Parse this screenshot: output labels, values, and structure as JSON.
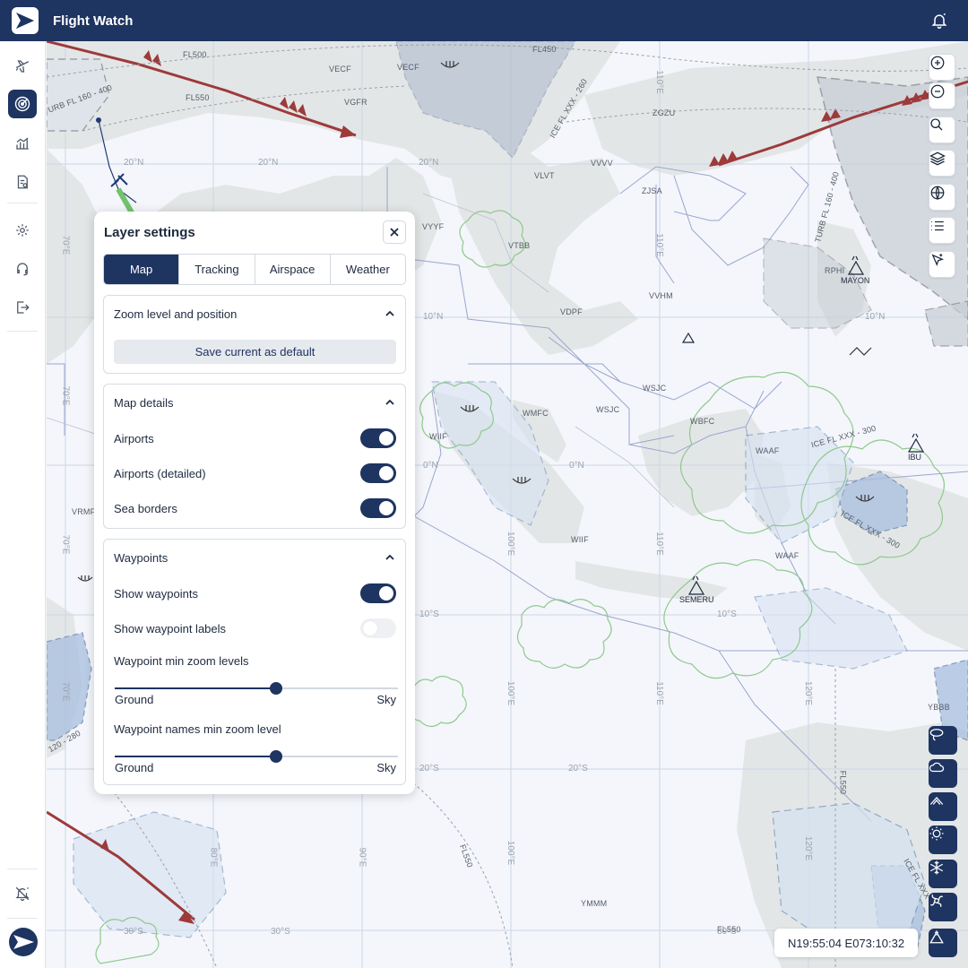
{
  "app": {
    "title": "Flight Watch"
  },
  "sidebar": {
    "items": [
      {
        "icon": "plane-icon"
      },
      {
        "icon": "radar-icon",
        "active": true
      },
      {
        "icon": "chart-icon"
      },
      {
        "icon": "report-icon"
      },
      {
        "icon": "settings-icon"
      },
      {
        "icon": "support-icon"
      },
      {
        "icon": "logout-icon"
      }
    ],
    "bottom": [
      {
        "icon": "notifications-off-icon"
      }
    ]
  },
  "map": {
    "labels": {
      "fl500": "FL500",
      "vecf": "VECF",
      "vecf_b": "VECF",
      "vgfr": "VGFR",
      "fl550": "FL550",
      "fl450": "FL450",
      "zgzu": "ZGZU",
      "vvvv": "VVVV",
      "zjsa": "ZJSA",
      "vlvt": "VLVT",
      "vyyf": "VYYF",
      "vtbb": "VTBB",
      "vdpf": "VDPF",
      "vvhm": "VVHM",
      "rphi": "RPHI",
      "wsjc": "WSJC",
      "wsjc_b": "WSJC",
      "wmfc": "WMFC",
      "wbfc": "WBFC",
      "waaf": "WAAF",
      "waaf_b": "WAAF",
      "wiif": "WIIF",
      "wiif_b": "WIIF",
      "vrmf": "VRMF",
      "yb_bb": "YBBB",
      "ymmm": "YMMM",
      "fl550_b": "FL550",
      "fl550_c": "FL550",
      "fl550_d": "FL550",
      "turb_a": "TURB FL 160 - 400",
      "turb_b": "TURB FL 160 - 400",
      "ice_a": "ICE FL XXX - 260",
      "ice_b": "ICE FL XXX - 300",
      "ice_c": "ICE FL XXX - 300",
      "ice_d": "ICE FL XXX - 240",
      "ice_e": "120 - 280"
    },
    "lat": {
      "n20a": "20°N",
      "n20b": "20°N",
      "n20c": "20°N",
      "n10a": "10°N",
      "n10b": "10°N",
      "eq_a": "0°N",
      "eq_b": "0°N",
      "s10a": "10°S",
      "s10b": "10°S",
      "s20a": "20°S",
      "s20b": "20°S",
      "s30a": "30°S",
      "s30b": "30°S",
      "s30c": "30°S"
    },
    "lon": {
      "e70a": "70°E",
      "e70b": "70°E",
      "e70c": "70°E",
      "e70d": "70°E",
      "e80a": "80°E",
      "e90a": "90°E",
      "e100a": "100°E",
      "e100b": "100°E",
      "e100c": "100°E",
      "e110a": "110°E",
      "e110b": "110°E",
      "e110c": "110°E",
      "e110d": "110°E",
      "e120a": "120°E",
      "e120b": "120°E"
    },
    "pois": {
      "mayon": "MAYON",
      "semeru": "SEMERU",
      "ibu": "IBU"
    },
    "coordinates": "N19:55:04 E073:10:32"
  },
  "controls": [
    "zoom-in-icon",
    "zoom-out-icon",
    "search-icon",
    "layers-icon",
    "globe-icon",
    "list-icon",
    "select-cursor-icon"
  ],
  "weather_controls": [
    "lasso-icon",
    "cloud-icon",
    "mountain-wave-icon",
    "sun-icon",
    "snowflake-icon",
    "hurricane-icon",
    "volcano-icon"
  ],
  "panel": {
    "title": "Layer settings",
    "tabs": [
      {
        "label": "Map",
        "active": true
      },
      {
        "label": "Tracking"
      },
      {
        "label": "Airspace"
      },
      {
        "label": "Weather"
      }
    ],
    "zoom_section": {
      "title": "Zoom level and position",
      "save_label": "Save current as default"
    },
    "map_details": {
      "title": "Map details",
      "airports": {
        "label": "Airports",
        "on": true
      },
      "airports_detailed": {
        "label": "Airports (detailed)",
        "on": true
      },
      "sea_borders": {
        "label": "Sea borders",
        "on": true
      }
    },
    "waypoints": {
      "title": "Waypoints",
      "show": {
        "label": "Show waypoints",
        "on": true
      },
      "show_labels": {
        "label": "Show waypoint labels",
        "on": false
      },
      "min_zoom": {
        "label": "Waypoint min zoom levels",
        "value": 0.57,
        "min_label": "Ground",
        "max_label": "Sky"
      },
      "names_min_zoom": {
        "label": "Waypoint names min zoom level",
        "value": 0.57,
        "min_label": "Ground",
        "max_label": "Sky"
      }
    }
  }
}
